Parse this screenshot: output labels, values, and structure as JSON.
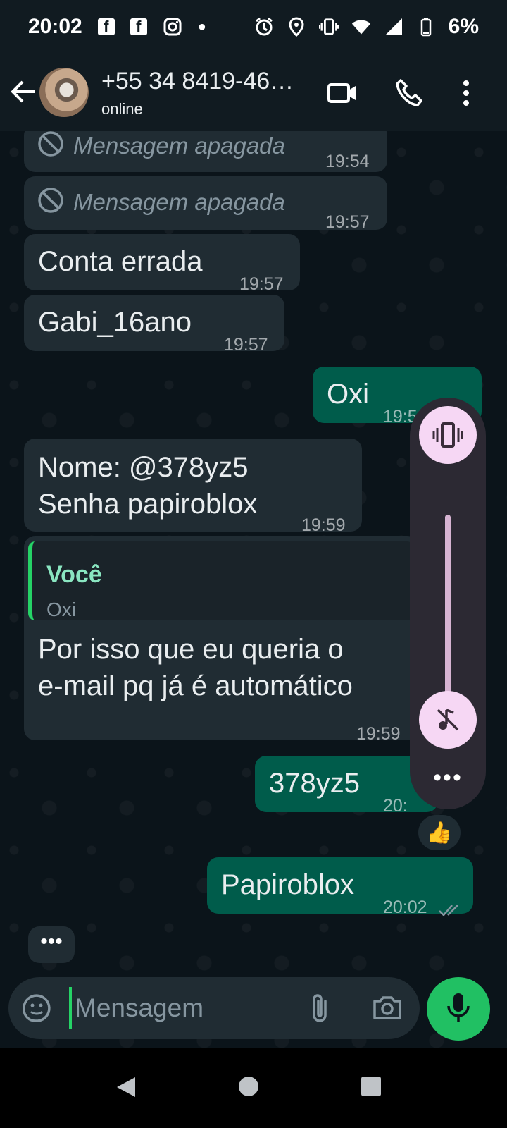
{
  "status_bar": {
    "time": "20:02",
    "battery": "6%"
  },
  "header": {
    "contact_name": "+55 34 8419-46…",
    "contact_status": "online"
  },
  "messages": [
    {
      "text": "Mensagem apagada",
      "time": "19:54"
    },
    {
      "text": "Mensagem apagada",
      "time": "19:57"
    },
    {
      "text": "Conta errada",
      "time": "19:57"
    },
    {
      "text": "Gabi_16ano",
      "time": "19:57"
    },
    {
      "text": "Oxi",
      "time": "19:59"
    },
    {
      "text_line1": "Nome: @378yz5",
      "text_line2": "Senha papiroblox",
      "time": "19:59"
    },
    {
      "quote_author": "Você",
      "quote_text": "Oxi",
      "text_line1": "Por isso que eu queria o",
      "text_line2": "e-mail pq já é automático",
      "time": "19:59"
    },
    {
      "text": "378yz5",
      "time": "20:"
    },
    {
      "text": "Papiroblox",
      "time": "20:02"
    }
  ],
  "reaction": "👍",
  "typing_indicator": "•••",
  "volume_panel": {
    "more": "•••",
    "level": 0.55
  },
  "input": {
    "placeholder": "Mensagem"
  },
  "colors": {
    "accent": "#25d366",
    "outgoing_bubble": "#005c4b",
    "incoming_bubble": "#202c33"
  }
}
